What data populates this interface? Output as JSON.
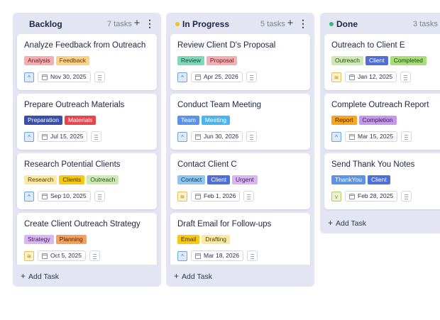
{
  "columns": [
    {
      "title": "Backlog",
      "count": "7 tasks",
      "add_task": "Add Task",
      "cards": [
        {
          "title": "Analyze Feedback from Outreach",
          "tags": [
            {
              "label": "Analysis",
              "bg": "#f5aeb2",
              "fg": "#5c1e24"
            },
            {
              "label": "Feedback",
              "bg": "#fcd28a",
              "fg": "#5a3a05"
            }
          ],
          "priority": "low",
          "priority_icon": "chevron-up-icon",
          "date": "Nov 30, 2025"
        },
        {
          "title": "Prepare Outreach Materials",
          "tags": [
            {
              "label": "Preparation",
              "bg": "#3a4fa8",
              "fg": "#ffffff"
            },
            {
              "label": "Materials",
              "bg": "#e5454d",
              "fg": "#ffffff"
            }
          ],
          "priority": "low",
          "priority_icon": "chevron-up-icon",
          "date": "Jul 15, 2025"
        },
        {
          "title": "Research Potential Clients",
          "tags": [
            {
              "label": "Research",
              "bg": "#fbe9a3",
              "fg": "#4d3d05"
            },
            {
              "label": "Clients",
              "bg": "#f7c914",
              "fg": "#3d3000"
            },
            {
              "label": "Outreach",
              "bg": "#cde9b4",
              "fg": "#2d4a16"
            }
          ],
          "priority": "low",
          "priority_icon": "chevron-up-icon",
          "date": "Sep 10, 2025"
        },
        {
          "title": "Create Client Outreach Strategy",
          "tags": [
            {
              "label": "Strategy",
              "bg": "#d7b6f2",
              "fg": "#3f1d5e"
            },
            {
              "label": "Planning",
              "bg": "#f5a05a",
              "fg": "#4a2206"
            }
          ],
          "priority": "med",
          "priority_icon": "double-chevron-up-icon",
          "date": "Oct 5, 2025"
        }
      ]
    },
    {
      "title": "In Progress",
      "count": "5 tasks",
      "dot_color": "#f2c417",
      "add_task": "Add Task",
      "cards": [
        {
          "title": "Review Client D's Proposal",
          "tags": [
            {
              "label": "Review",
              "bg": "#7fd8b9",
              "fg": "#0d4a36"
            },
            {
              "label": "Proposal",
              "bg": "#f5aeb2",
              "fg": "#5c1e24"
            }
          ],
          "priority": "low",
          "priority_icon": "chevron-up-icon",
          "date": "Apr 25, 2026"
        },
        {
          "title": "Conduct Team Meeting",
          "tags": [
            {
              "label": "Team",
              "bg": "#5b93e6",
              "fg": "#ffffff"
            },
            {
              "label": "Meeting",
              "bg": "#4cb4ea",
              "fg": "#ffffff"
            }
          ],
          "priority": "low",
          "priority_icon": "chevron-up-icon",
          "date": "Jun 30, 2026"
        },
        {
          "title": "Contact Client C",
          "tags": [
            {
              "label": "Contact",
              "bg": "#8fc6ef",
              "fg": "#0d3656"
            },
            {
              "label": "Client",
              "bg": "#4f6fd6",
              "fg": "#ffffff"
            },
            {
              "label": "Urgent",
              "bg": "#d7b6f2",
              "fg": "#3f1d5e"
            }
          ],
          "priority": "med",
          "priority_icon": "double-chevron-up-icon",
          "date": "Feb 1, 2026"
        },
        {
          "title": "Draft Email for Follow-ups",
          "tags": [
            {
              "label": "Email",
              "bg": "#f7c914",
              "fg": "#3d3000"
            },
            {
              "label": "Drafting",
              "bg": "#fbe9a3",
              "fg": "#4d3d05"
            }
          ],
          "priority": "low",
          "priority_icon": "chevron-up-icon",
          "date": "Mar 18, 2026"
        }
      ]
    },
    {
      "title": "Done",
      "count": "3 tasks",
      "dot_color": "#2fb986",
      "add_task": "Add Task",
      "cards": [
        {
          "title": "Outreach to Client E",
          "tags": [
            {
              "label": "Outreach",
              "bg": "#cde9b4",
              "fg": "#2d4a16"
            },
            {
              "label": "Client",
              "bg": "#4f6fd6",
              "fg": "#ffffff"
            },
            {
              "label": "Completed",
              "bg": "#a7dd7a",
              "fg": "#20440a"
            }
          ],
          "priority": "med",
          "priority_icon": "double-chevron-up-icon",
          "date": "Jan 12, 2025"
        },
        {
          "title": "Complete Outreach Report",
          "tags": [
            {
              "label": "Report",
              "bg": "#f7a61f",
              "fg": "#3d2500"
            },
            {
              "label": "Completion",
              "bg": "#c49ae8",
              "fg": "#3a1a57"
            }
          ],
          "priority": "low",
          "priority_icon": "chevron-up-icon",
          "date": "Mar 15, 2025"
        },
        {
          "title": "Send Thank You Notes",
          "tags": [
            {
              "label": "ThankYou",
              "bg": "#5b93e6",
              "fg": "#ffffff"
            },
            {
              "label": "Client",
              "bg": "#4f6fd6",
              "fg": "#ffffff"
            }
          ],
          "priority": "down",
          "priority_icon": "chevron-down-icon",
          "date": "Feb 28, 2025"
        }
      ]
    }
  ]
}
